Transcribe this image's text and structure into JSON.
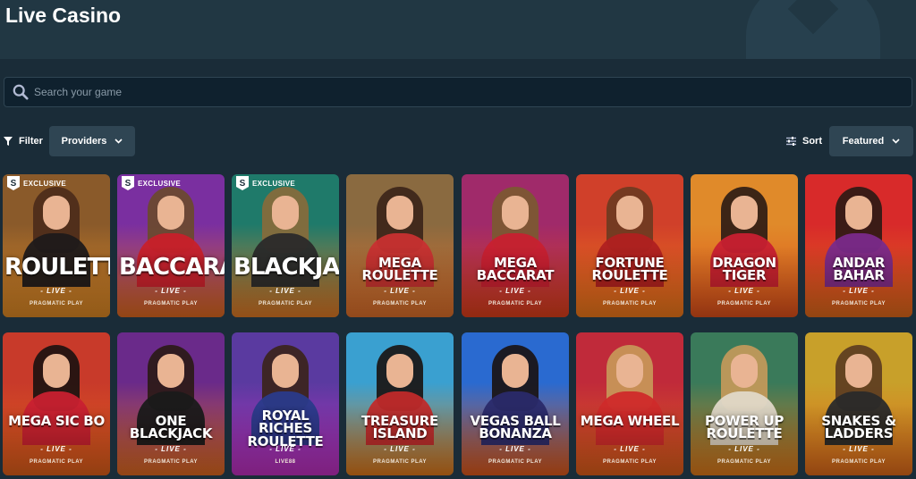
{
  "page": {
    "title": "Live Casino"
  },
  "search": {
    "placeholder": "Search your game",
    "icon": "search-icon"
  },
  "filter": {
    "label": "Filter",
    "providers_label": "Providers"
  },
  "sort": {
    "label": "Sort",
    "selected": "Featured"
  },
  "colors": {
    "page_bg": "#1a2c38",
    "header_bg": "#213743",
    "control_bg": "#2f4553",
    "input_bg": "#0f212e"
  },
  "games": [
    {
      "title": "ROULETTE",
      "live": "- LIVE -",
      "provider": "PRAGMATIC PLAY",
      "badge": "EXCLUSIVE",
      "style": "big",
      "bg": [
        "#8a5a2a",
        "#e08a25"
      ],
      "body": "#1f1a1a",
      "hair": "#4a2a1a"
    },
    {
      "title": "BACCARAT",
      "live": "- LIVE -",
      "provider": "PRAGMATIC PLAY",
      "badge": "EXCLUSIVE",
      "style": "big",
      "bg": [
        "#7a2fa0",
        "#e06a20"
      ],
      "body": "#c8202a",
      "hair": "#6a4a2a"
    },
    {
      "title": "BLACKJACK",
      "live": "- LIVE -",
      "provider": "PRAGMATIC PLAY",
      "badge": "EXCLUSIVE",
      "style": "big",
      "bg": [
        "#1f7a6a",
        "#e07a25"
      ],
      "body": "#2a2a2a",
      "hair": "#8a6a3a"
    },
    {
      "title": "MEGA ROULETTE",
      "live": "- LIVE -",
      "provider": "PRAGMATIC PLAY",
      "badge": "",
      "style": "two",
      "bg": [
        "#8a6a40",
        "#e0702a"
      ],
      "body": "#c83030",
      "hair": "#3a2418"
    },
    {
      "title": "MEGA BACCARAT",
      "live": "- LIVE -",
      "provider": "PRAGMATIC PLAY",
      "badge": "",
      "style": "two",
      "bg": [
        "#a02a6a",
        "#e0401a"
      ],
      "body": "#c82030",
      "hair": "#7a5a30"
    },
    {
      "title": "FORTUNE ROULETTE",
      "live": "- LIVE -",
      "provider": "PRAGMATIC PLAY",
      "badge": "",
      "style": "two",
      "bg": [
        "#d0402a",
        "#f07a1a"
      ],
      "body": "#b02020",
      "hair": "#6a3a20"
    },
    {
      "title": "DRAGON TIGER",
      "live": "- LIVE -",
      "provider": "PRAGMATIC PLAY",
      "badge": "",
      "style": "two",
      "bg": [
        "#e08a2a",
        "#e0501a"
      ],
      "body": "#c82030",
      "hair": "#2a1a14"
    },
    {
      "title": "ANDAR BAHAR",
      "live": "- LIVE -",
      "provider": "PRAGMATIC PLAY",
      "badge": "",
      "style": "two",
      "bg": [
        "#d82a2a",
        "#e06a1a"
      ],
      "body": "#7a2a8a",
      "hair": "#2a1a14"
    },
    {
      "title": "MEGA SIC BO",
      "live": "- LIVE -",
      "provider": "PRAGMATIC PLAY",
      "badge": "",
      "style": "two",
      "bg": [
        "#c83a2a",
        "#e0601a"
      ],
      "body": "#c82030",
      "hair": "#1a1210"
    },
    {
      "title": "ONE BLACKJACK",
      "live": "- LIVE -",
      "provider": "PRAGMATIC PLAY",
      "badge": "",
      "style": "two",
      "bg": [
        "#6a2a8a",
        "#e06a20"
      ],
      "body": "#1a1a1a",
      "hair": "#2a1a14"
    },
    {
      "title": "ROYAL RICHES ROULETTE",
      "live": "- LIVE -",
      "provider": "LIVE88",
      "badge": "",
      "style": "two2",
      "bg": [
        "#5a3aa0",
        "#c030c0"
      ],
      "body": "#2a3a8a",
      "hair": "#3a2418"
    },
    {
      "title": "TREASURE ISLAND",
      "live": "- LIVE -",
      "provider": "PRAGMATIC PLAY",
      "badge": "",
      "style": "two",
      "bg": [
        "#3aa0d0",
        "#e07a1a"
      ],
      "body": "#c02a2a",
      "hair": "#1a1210"
    },
    {
      "title": "VEGAS BALL BONANZA",
      "live": "- LIVE -",
      "provider": "PRAGMATIC PLAY",
      "badge": "",
      "style": "two",
      "bg": [
        "#2a6ad0",
        "#e05a1a"
      ],
      "body": "#2a2a6a",
      "hair": "#1a1210"
    },
    {
      "title": "MEGA WHEEL",
      "live": "- LIVE -",
      "provider": "PRAGMATIC PLAY",
      "badge": "",
      "style": "two",
      "bg": [
        "#c02a3a",
        "#e0601a"
      ],
      "body": "#d02a2a",
      "hair": "#c89a5a"
    },
    {
      "title": "POWER UP ROULETTE",
      "live": "- LIVE -",
      "provider": "PRAGMATIC PLAY",
      "badge": "",
      "style": "two",
      "bg": [
        "#3a7a5a",
        "#e07a1a"
      ],
      "body": "#e0d8c8",
      "hair": "#c89a5a"
    },
    {
      "title": "SNAKES & LADDERS",
      "live": "- LIVE -",
      "provider": "PRAGMATIC PLAY",
      "badge": "",
      "style": "two",
      "bg": [
        "#c8a02a",
        "#e06a1a"
      ],
      "body": "#2a2a2a",
      "hair": "#5a3a20"
    }
  ]
}
